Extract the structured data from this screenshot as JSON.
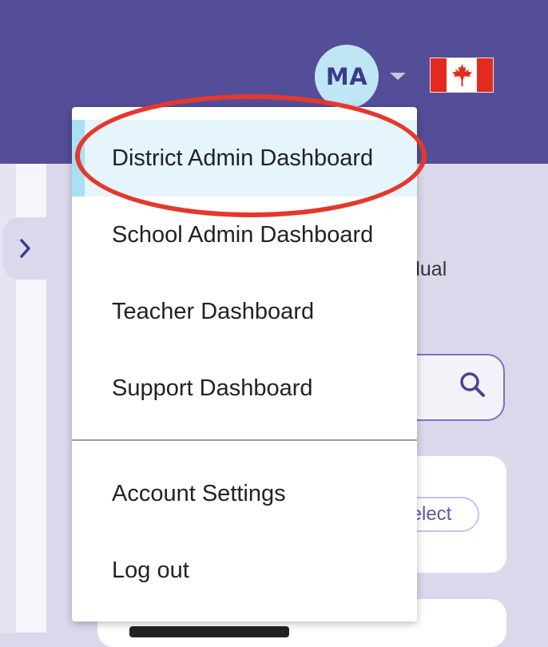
{
  "header": {
    "avatar_initials": "MA",
    "avatar_color": "#bfe6f5",
    "bar_color": "#544d98",
    "caret_icon": "caret-down-icon",
    "flag_icon": "canada-flag-icon"
  },
  "background_page": {
    "expand_icon": "chevron-right-icon",
    "partial_text": "dual",
    "search_icon": "search-icon",
    "select_button_label": "elect"
  },
  "user_menu": {
    "items": [
      {
        "label": "District Admin Dashboard",
        "active": true
      },
      {
        "label": "School Admin Dashboard"
      },
      {
        "label": "Teacher Dashboard"
      },
      {
        "label": "Support Dashboard"
      },
      {
        "label": "Account Settings"
      },
      {
        "label": "Log out"
      }
    ],
    "highlight_color": "#e5382d"
  }
}
